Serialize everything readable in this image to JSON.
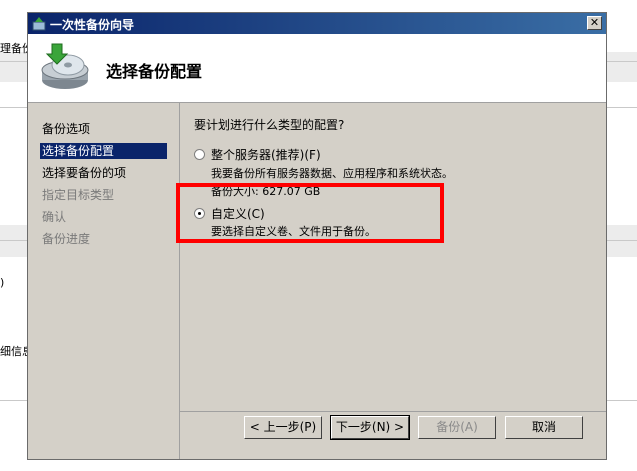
{
  "background_app": {
    "text_lines": [
      "理备份",
      ")",
      "细信息"
    ]
  },
  "window": {
    "title": "一次性备份向导",
    "close_glyph": "✕"
  },
  "header": {
    "heading": "选择备份配置"
  },
  "nav": {
    "items": [
      {
        "label": "备份选项",
        "state": "normal"
      },
      {
        "label": "选择备份配置",
        "state": "current"
      },
      {
        "label": "选择要备份的项",
        "state": "normal"
      },
      {
        "label": "指定目标类型",
        "state": "disabled"
      },
      {
        "label": "确认",
        "state": "disabled"
      },
      {
        "label": "备份进度",
        "state": "disabled"
      }
    ]
  },
  "content": {
    "question": "要计划进行什么类型的配置?",
    "options": [
      {
        "label": "整个服务器(推荐)(F)",
        "description": "我要备份所有服务器数据、应用程序和系统状态。",
        "size": "备份大小: 627.07 GB",
        "selected": false
      },
      {
        "label": "自定义(C)",
        "description": "要选择自定义卷、文件用于备份。",
        "selected": true
      }
    ]
  },
  "buttons": {
    "back": "< 上一步(P)",
    "next": "下一步(N) >",
    "backup": "备份(A)",
    "cancel": "取消"
  },
  "colors": {
    "highlight_box": "#ff0000",
    "selection": "#0a246a",
    "dialog_face": "#d4d0c8"
  }
}
